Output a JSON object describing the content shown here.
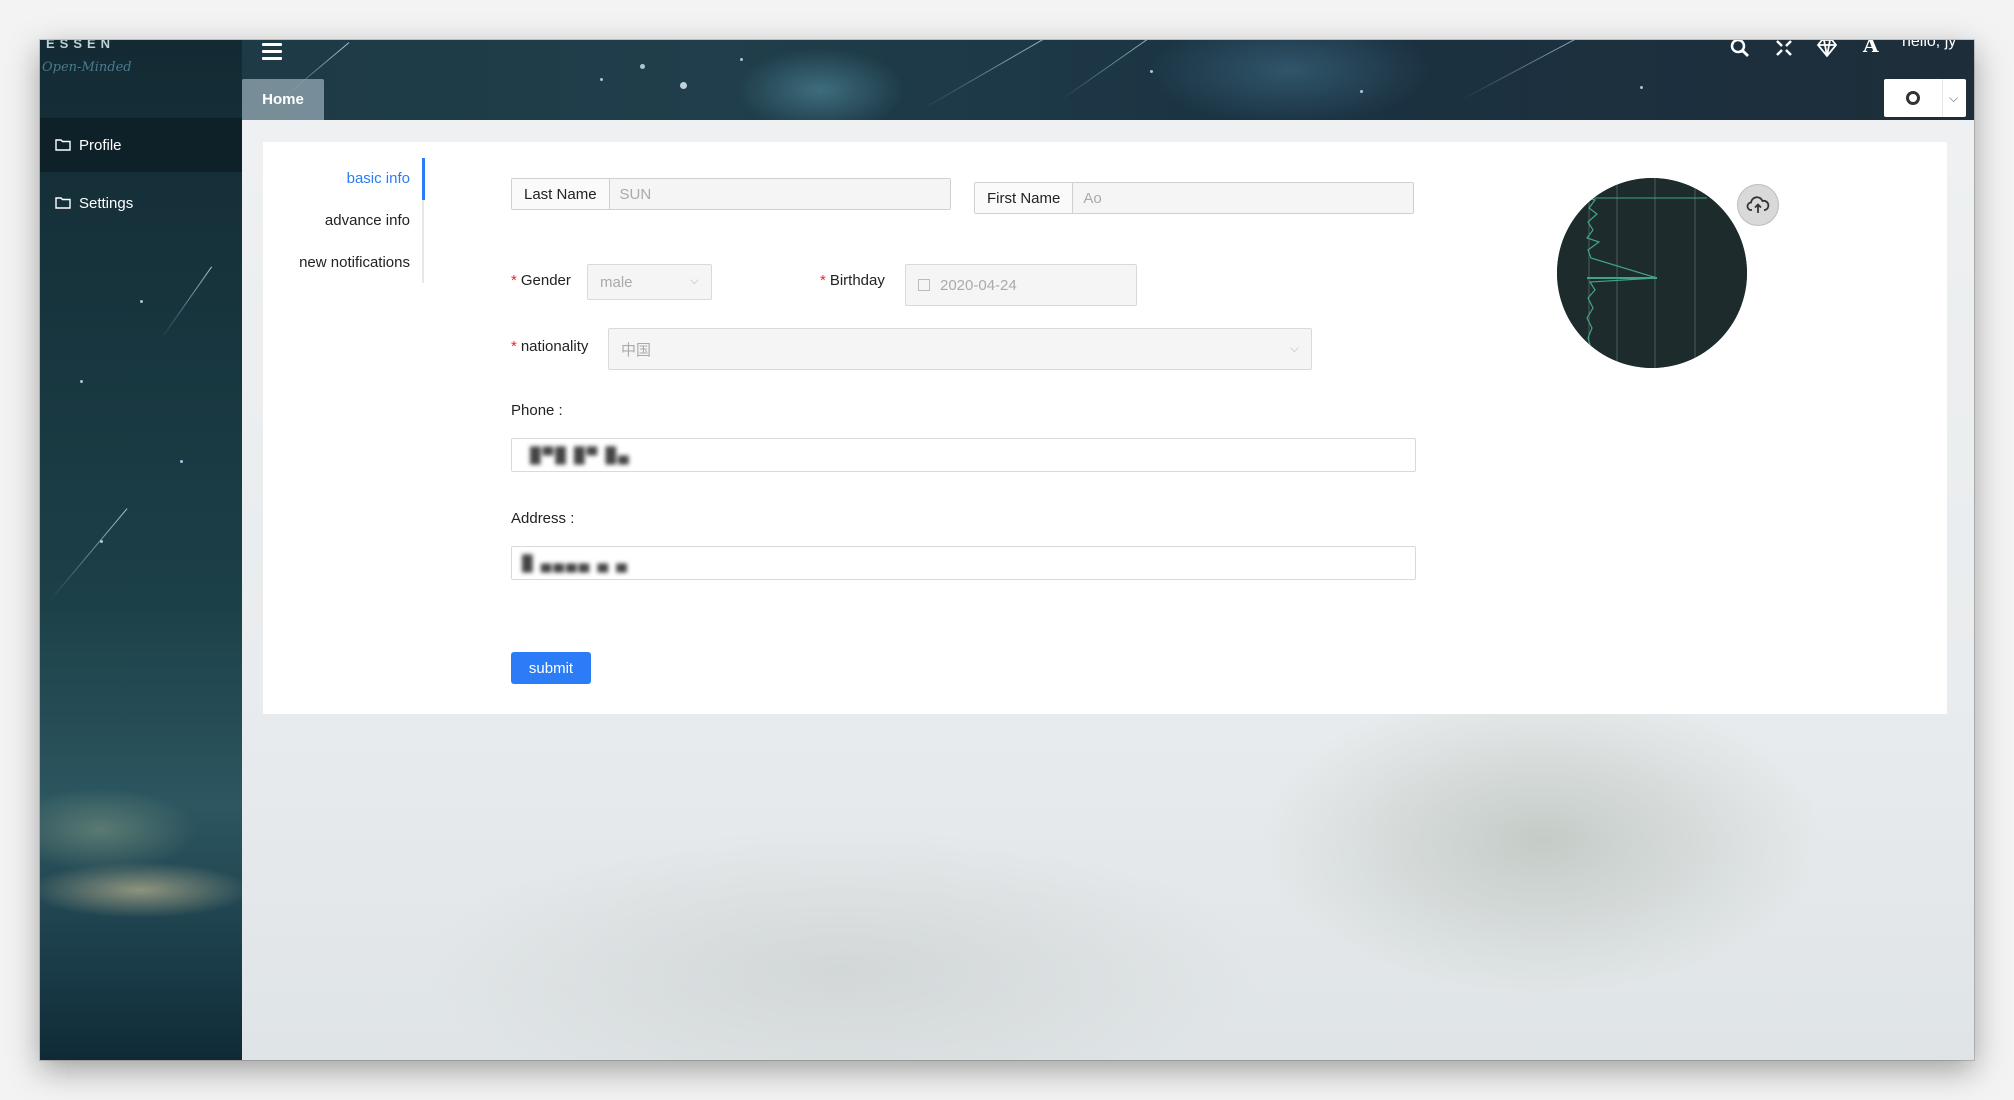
{
  "sidebar": {
    "logo": "ESSEN",
    "logo_sub": "Open-Minded",
    "items": [
      {
        "label": "Profile",
        "icon": "folder-icon"
      },
      {
        "label": "Settings",
        "icon": "folder-icon"
      }
    ]
  },
  "header": {
    "tabs": [
      {
        "label": "Home"
      }
    ],
    "tools": [
      "search-icon",
      "fullscreen-icon",
      "diamond-icon",
      "font-icon"
    ],
    "greeting": "hello, jy"
  },
  "subnav": {
    "items": [
      {
        "label": "basic info",
        "active": true
      },
      {
        "label": "advance info",
        "active": false
      },
      {
        "label": "new notifications",
        "active": false
      }
    ]
  },
  "form": {
    "last_name": {
      "label": "Last Name",
      "value": "SUN"
    },
    "first_name": {
      "label": "First Name",
      "value": "Ao"
    },
    "gender": {
      "label": "Gender",
      "value": "male",
      "required": true
    },
    "birthday": {
      "label": "Birthday",
      "value": "2020-04-24",
      "required": true
    },
    "nationality": {
      "label": "nationality",
      "value": "中国",
      "required": true
    },
    "phone": {
      "label": "Phone",
      "value": "█▀█ █▀ █▄"
    },
    "address": {
      "label": "Address",
      "value": "█ ▄▄▄▄ ▄ ▄"
    },
    "submit_label": "submit"
  },
  "colors": {
    "primary": "#2b7cf6",
    "required": "#f5222d"
  }
}
